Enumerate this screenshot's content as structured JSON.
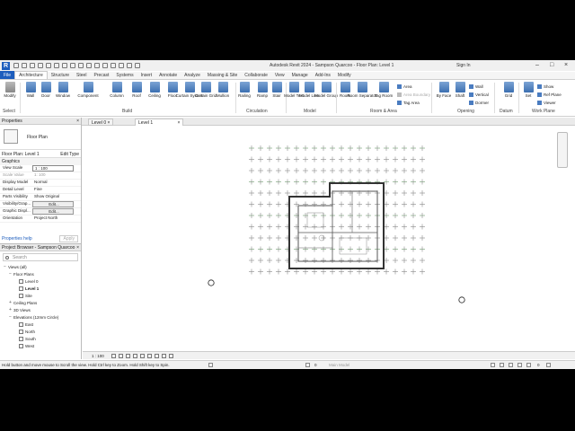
{
  "title": "Autodesk Revit 2024 - Sampson Quarcoo - Floor Plan: Level 1",
  "signin": "Sign In",
  "tabs": [
    "File",
    "Architecture",
    "Structure",
    "Steel",
    "Precast",
    "Systems",
    "Insert",
    "Annotate",
    "Analyze",
    "Massing & Site",
    "Collaborate",
    "View",
    "Manage",
    "Add-Ins",
    "Modify"
  ],
  "ribbon": {
    "modify": "Modify",
    "select": "Select",
    "build_tools": [
      "Wall",
      "Door",
      "Window",
      "Component",
      "Column",
      "Roof",
      "Ceiling",
      "Floor",
      "Curtain System",
      "Curtain Grid",
      "Mullion"
    ],
    "build_label": "Build",
    "circ_tools": [
      "Railing",
      "Ramp",
      "Stair"
    ],
    "circ_label": "Circulation",
    "model_tools": [
      "Model Text",
      "Model Line",
      "Model Group"
    ],
    "model_label": "Model",
    "room_tools": [
      "Room",
      "Room Separator",
      "Tag Room"
    ],
    "room_small": [
      "Area",
      "Area Boundary",
      "Tag Area"
    ],
    "room_label": "Room & Area",
    "opening_tools": [
      "By Face",
      "Shaft"
    ],
    "opening_small": [
      "Wall",
      "Vertical",
      "Dormer"
    ],
    "opening_label": "Opening",
    "datum_tools": [
      "Grid"
    ],
    "datum_label": "Datum",
    "wp_tools": [
      "Set"
    ],
    "wp_small": [
      "Show",
      "Ref Plane",
      "Viewer"
    ],
    "wp_label": "Work Plane"
  },
  "view_tabs": [
    "Level 0",
    "Level 1"
  ],
  "properties": {
    "header": "Properties",
    "type_name": "Floor Plan",
    "instance": "Floor Plan: Level 1",
    "edit_type": "Edit Type",
    "group": "Graphics",
    "rows": [
      {
        "k": "View Scale",
        "v": "1 : 100"
      },
      {
        "k": "Scale Value",
        "v": "1:  100"
      },
      {
        "k": "Display Model",
        "v": "Normal"
      },
      {
        "k": "Detail Level",
        "v": "Fine"
      },
      {
        "k": "Parts Visibility",
        "v": "Show Original"
      },
      {
        "k": "Visibility/Grap...",
        "v": "Edit..."
      },
      {
        "k": "Graphic Displ...",
        "v": "Edit..."
      },
      {
        "k": "Orientation",
        "v": "Project North"
      }
    ],
    "help": "Properties help",
    "apply": "Apply"
  },
  "browser": {
    "header": "Project Browser - Sampson Quarcoo",
    "search": "Search",
    "items": [
      {
        "label": "Views (all)",
        "lvl": 0,
        "tog": "−"
      },
      {
        "label": "Floor Plans",
        "lvl": 1,
        "tog": "−"
      },
      {
        "label": "Level 0",
        "lvl": 2,
        "tog": ""
      },
      {
        "label": "Level 1",
        "lvl": 2,
        "tog": ""
      },
      {
        "label": "Site",
        "lvl": 2,
        "tog": ""
      },
      {
        "label": "Ceiling Plans",
        "lvl": 1,
        "tog": "+"
      },
      {
        "label": "3D Views",
        "lvl": 1,
        "tog": "+"
      },
      {
        "label": "Elevations (12mm Circle)",
        "lvl": 1,
        "tog": "−"
      },
      {
        "label": "East",
        "lvl": 2,
        "tog": ""
      },
      {
        "label": "North",
        "lvl": 2,
        "tog": ""
      },
      {
        "label": "South",
        "lvl": 2,
        "tog": ""
      },
      {
        "label": "West",
        "lvl": 2,
        "tog": ""
      }
    ]
  },
  "viewbar": {
    "scale": "1 : 100"
  },
  "status": {
    "text": "Hold button and move mouse to Scroll the view. Hold Ctrl key to Zoom. Hold Shift key to Spin.",
    "model": "Main Model",
    "zero": "0"
  }
}
